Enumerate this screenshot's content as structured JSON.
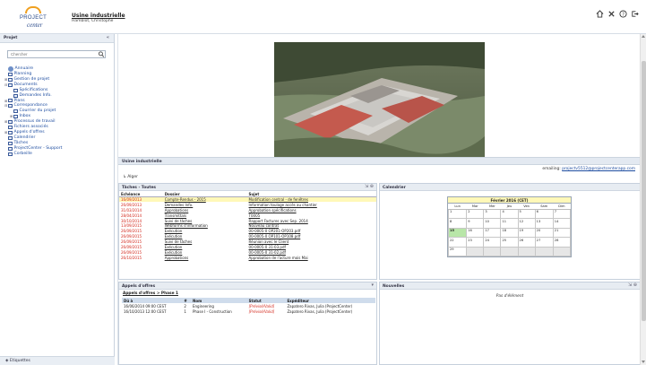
{
  "header": {
    "logo_line1": "PROJECT",
    "logo_line2": "center",
    "project_title": "Usine industrielle",
    "user_name": "Hamblot, Christophe",
    "icons": [
      "home-icon",
      "tools-icon",
      "help-icon",
      "logout-icon"
    ]
  },
  "sidebar": {
    "title": "Projet",
    "search_placeholder": "Chercher",
    "footer": "Etiquettes",
    "tree": [
      {
        "label": "Annuaire",
        "icon": "users-icon",
        "toggle": ""
      },
      {
        "label": "Planning",
        "icon": "calendar-icon",
        "toggle": ""
      },
      {
        "label": "Gestion de projet",
        "icon": "folder-icon",
        "toggle": "⊞"
      },
      {
        "label": "Documents",
        "icon": "folder-icon",
        "toggle": "⊟"
      },
      {
        "label": "Spécifications",
        "icon": "folder-icon",
        "toggle": "",
        "indent": 1
      },
      {
        "label": "Demandes Info.",
        "icon": "doc-icon",
        "toggle": "",
        "indent": 1
      },
      {
        "label": "Plans",
        "icon": "folder-icon",
        "toggle": "⊞"
      },
      {
        "label": "Correspondance",
        "icon": "folder-icon",
        "toggle": "⊟"
      },
      {
        "label": "Courrier du projet",
        "icon": "mail-icon",
        "toggle": "",
        "indent": 1
      },
      {
        "label": "Inbox",
        "icon": "folder-icon",
        "toggle": "⊞",
        "indent": 1
      },
      {
        "label": "Processus de travail",
        "icon": "folder-icon",
        "toggle": "⊞"
      },
      {
        "label": "Fichiers associés",
        "icon": "files-icon",
        "toggle": ""
      },
      {
        "label": "Appels d'offres",
        "icon": "folder-icon",
        "toggle": "⊞"
      },
      {
        "label": "Calendrier",
        "icon": "calendar-icon",
        "toggle": ""
      },
      {
        "label": "Tâches",
        "icon": "tasks-icon",
        "toggle": ""
      },
      {
        "label": "ProjectCenter - Support",
        "icon": "support-icon",
        "toggle": ""
      },
      {
        "label": "Corbeille",
        "icon": "trash-icon",
        "toggle": ""
      }
    ]
  },
  "main": {
    "section_title": "Usine industrielle",
    "email_label": "emailing:",
    "email_address": "projectv5512@projectcenterapp.com",
    "alert_link": "Alger",
    "tasks": {
      "title": "Tâches - Toutes",
      "headers": [
        "Echéance",
        "Dossier",
        "Sujet"
      ],
      "rows": [
        {
          "date": "16/09/2013",
          "folder": "Compte-Rendus - 2015",
          "subject": "Modification central - de fenêtres",
          "late": true,
          "highlight": true
        },
        {
          "date": "26/09/2013",
          "folder": "Demandes Info.",
          "subject": "Information toulage accès au chantier",
          "late": true,
          "highlight": false
        },
        {
          "date": "31/03/2014",
          "folder": "Approbations",
          "subject": "Approbation spécifications",
          "late": true,
          "highlight": false
        },
        {
          "date": "28/04/2014",
          "folder": "Transmittals",
          "subject": "T0005",
          "late": true,
          "highlight": false
        },
        {
          "date": "30/10/2014",
          "folder": "Suivi de tâches",
          "subject": "Rapport Factures avec Sep. 2014",
          "late": true,
          "highlight": false
        },
        {
          "date": "13/09/2015",
          "folder": "Webforms d'information",
          "subject": "Nouveau contrat",
          "late": true,
          "highlight": false
        },
        {
          "date": "26/09/2015",
          "folder": "Exécution",
          "subject": "00-0005-0 OP201-OP203.pdf",
          "late": true,
          "highlight": false
        },
        {
          "date": "26/09/2015",
          "folder": "Exécution",
          "subject": "00-0005-0 OP101-OP108.pdf",
          "late": true,
          "highlight": false
        },
        {
          "date": "26/09/2015",
          "folder": "Suivi de tâches",
          "subject": "Réunion avec le Client",
          "late": true,
          "highlight": false
        },
        {
          "date": "26/09/2015",
          "folder": "Exécution",
          "subject": "00-0005-0 31-03.pdf",
          "late": true,
          "highlight": false
        },
        {
          "date": "26/09/2015",
          "folder": "Exécution",
          "subject": "00-0005-0 31-02.pdf",
          "late": true,
          "highlight": false
        },
        {
          "date": "26/10/2015",
          "folder": "Approbations",
          "subject": "Approbation de l'acture mois Mai",
          "late": true,
          "highlight": false
        }
      ]
    },
    "calendar": {
      "title": "Calendrier",
      "month_title": "Février 2016 (CET)",
      "weekdays": [
        "Lun",
        "Mar",
        "Mer",
        "Jeu",
        "Ven",
        "Sam",
        "Dim"
      ],
      "weeks": [
        [
          "1",
          "2",
          "3",
          "4",
          "5",
          "6",
          "7"
        ],
        [
          "8",
          "9",
          "10",
          "11",
          "12",
          "13",
          "14"
        ],
        [
          "15",
          "16",
          "17",
          "18",
          "19",
          "20",
          "21"
        ],
        [
          "22",
          "23",
          "24",
          "25",
          "26",
          "27",
          "28"
        ],
        [
          "29",
          "",
          "",
          "",
          "",
          "",
          ""
        ]
      ],
      "today": "15"
    },
    "appels": {
      "title": "Appels d'offres",
      "crumb": "Appels d'offres > Phase 1",
      "headers": [
        "Dû à",
        "#",
        "Nom",
        "Statut",
        "Expéditeur"
      ],
      "rows": [
        {
          "due": "16/06/2014 09:00 CEST",
          "num": "2",
          "name": "Engineering",
          "status": "[Prévisé/Valid]",
          "sender": "Zapatero Rivas, Julia (ProjectCenter)"
        },
        {
          "due": "16/10/2013 12:00 CEST",
          "num": "1",
          "name": "Phase I - Construction",
          "status": "[Prévisé/Valid]",
          "sender": "Zapatero Rivas, Julia (ProjectCenter)"
        }
      ]
    },
    "news": {
      "title": "Nouvelles",
      "empty_text": "Pas d'élément"
    }
  },
  "colors": {
    "accent": "#1e4da0",
    "late": "#d3271b",
    "highlight": "#fff8b8",
    "today": "#b8e6a8"
  }
}
